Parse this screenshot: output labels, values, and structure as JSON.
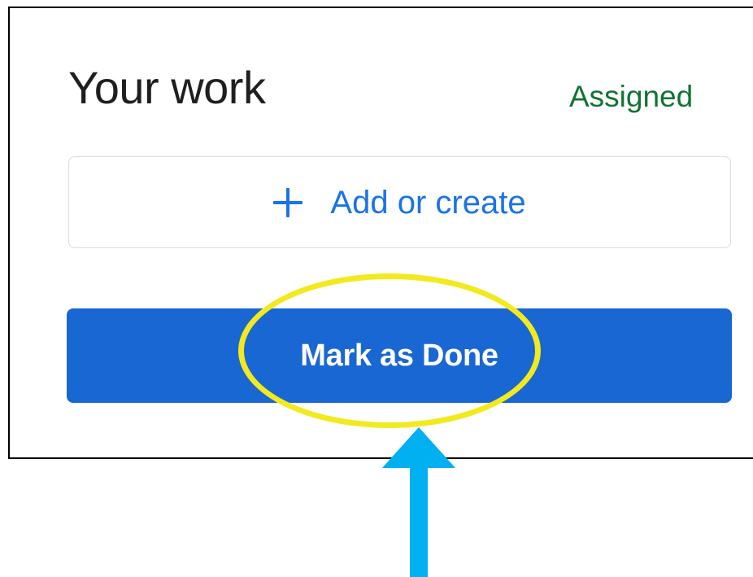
{
  "work_panel": {
    "title": "Your work",
    "status": "Assigned",
    "add_button_label": "Add or create",
    "mark_done_label": "Mark as Done"
  },
  "icons": {
    "add": "plus-icon"
  },
  "annotation": {
    "highlight_color": "#f2ea1e",
    "arrow_color": "#00b0f0"
  },
  "colors": {
    "primary": "#1967d2",
    "link_blue": "#1a73e8",
    "status_green": "#137333"
  }
}
